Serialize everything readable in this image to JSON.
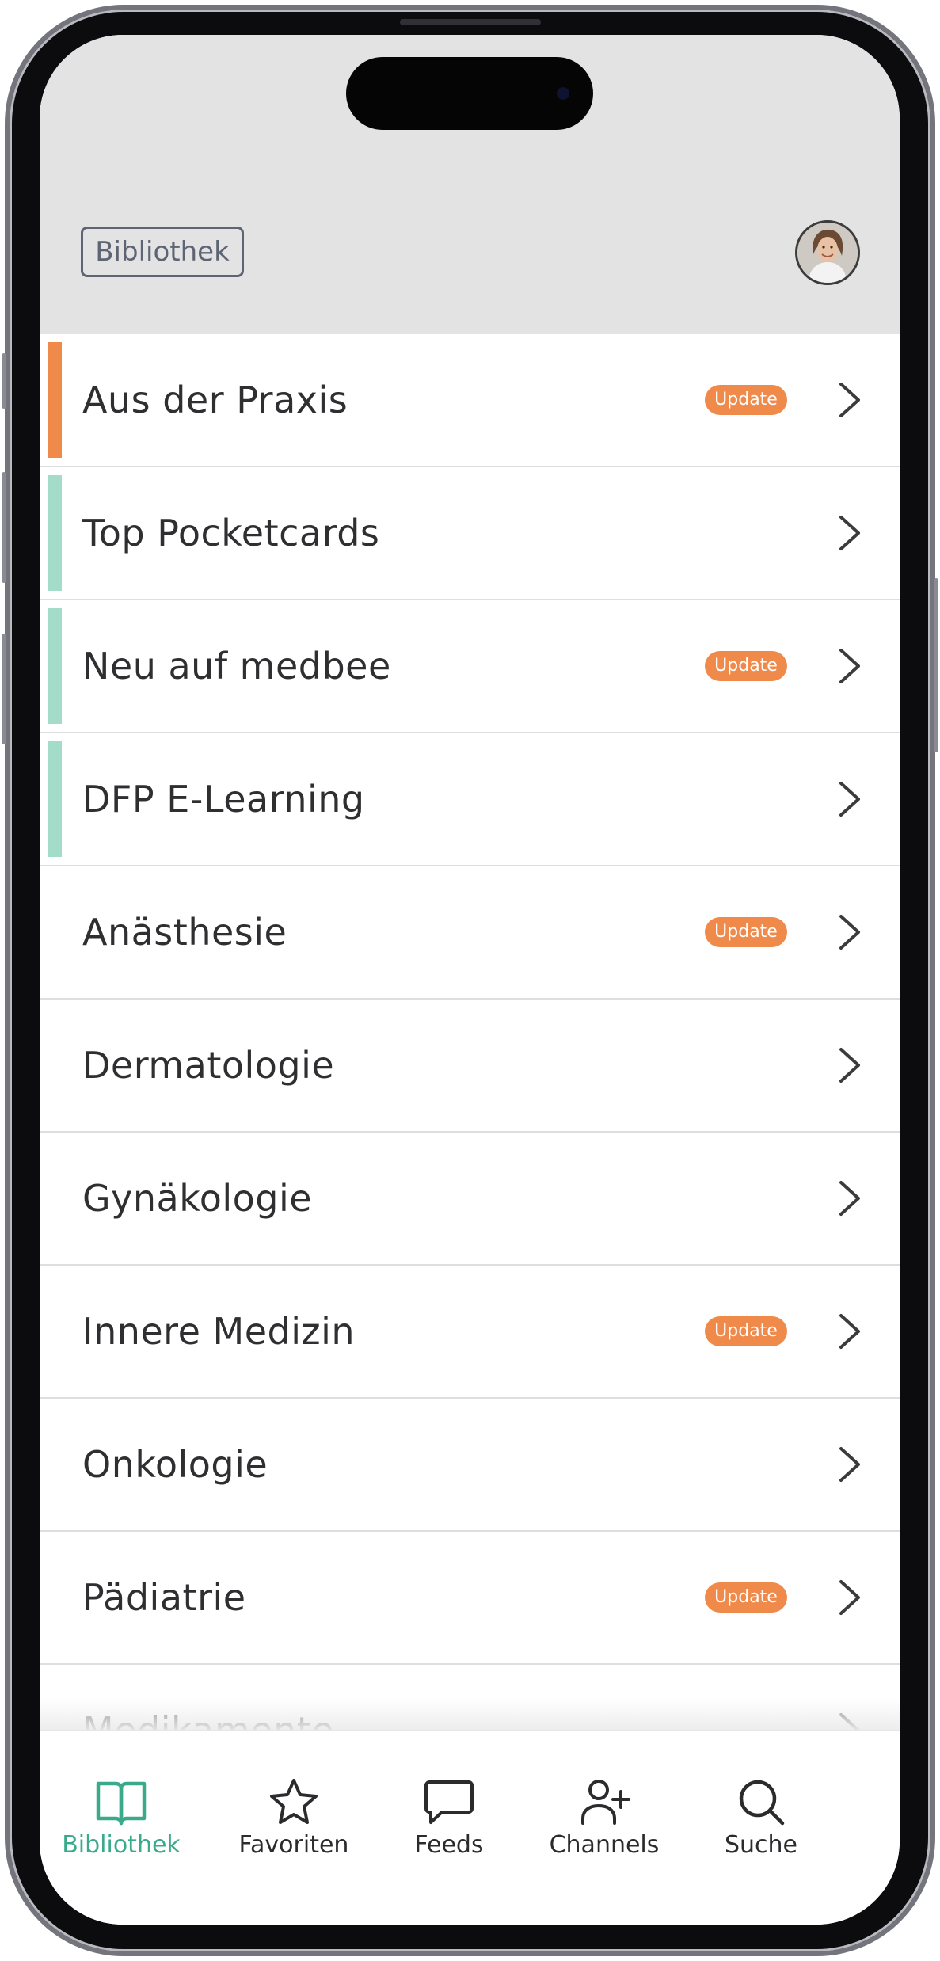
{
  "header": {
    "title_tag": "Bibliothek"
  },
  "colors": {
    "accent_orange": "#f08a4b",
    "accent_mint": "#a3dcc9",
    "active_tab": "#3aaa8a",
    "header_bg": "#e3e3e3"
  },
  "list": {
    "items": [
      {
        "label": "Aus der Praxis",
        "badge": "Update",
        "accent": "orange"
      },
      {
        "label": "Top Pocketcards",
        "badge": "",
        "accent": "mint"
      },
      {
        "label": "Neu auf medbee",
        "badge": "Update",
        "accent": "mint"
      },
      {
        "label": "DFP E-Learning",
        "badge": "",
        "accent": "mint"
      },
      {
        "label": "Anästhesie",
        "badge": "Update",
        "accent": ""
      },
      {
        "label": "Dermatologie",
        "badge": "",
        "accent": ""
      },
      {
        "label": "Gynäkologie",
        "badge": "",
        "accent": ""
      },
      {
        "label": "Innere Medizin",
        "badge": "Update",
        "accent": ""
      },
      {
        "label": "Onkologie",
        "badge": "",
        "accent": ""
      },
      {
        "label": "Pädiatrie",
        "badge": "Update",
        "accent": ""
      },
      {
        "label": "Medikamente",
        "badge": "",
        "accent": ""
      }
    ]
  },
  "tabbar": {
    "tabs": [
      {
        "label": "Bibliothek",
        "icon": "book-icon",
        "active": true
      },
      {
        "label": "Favoriten",
        "icon": "star-icon",
        "active": false
      },
      {
        "label": "Feeds",
        "icon": "chat-bubble-icon",
        "active": false
      },
      {
        "label": "Channels",
        "icon": "add-user-icon",
        "active": false
      },
      {
        "label": "Suche",
        "icon": "search-icon",
        "active": false
      }
    ]
  }
}
